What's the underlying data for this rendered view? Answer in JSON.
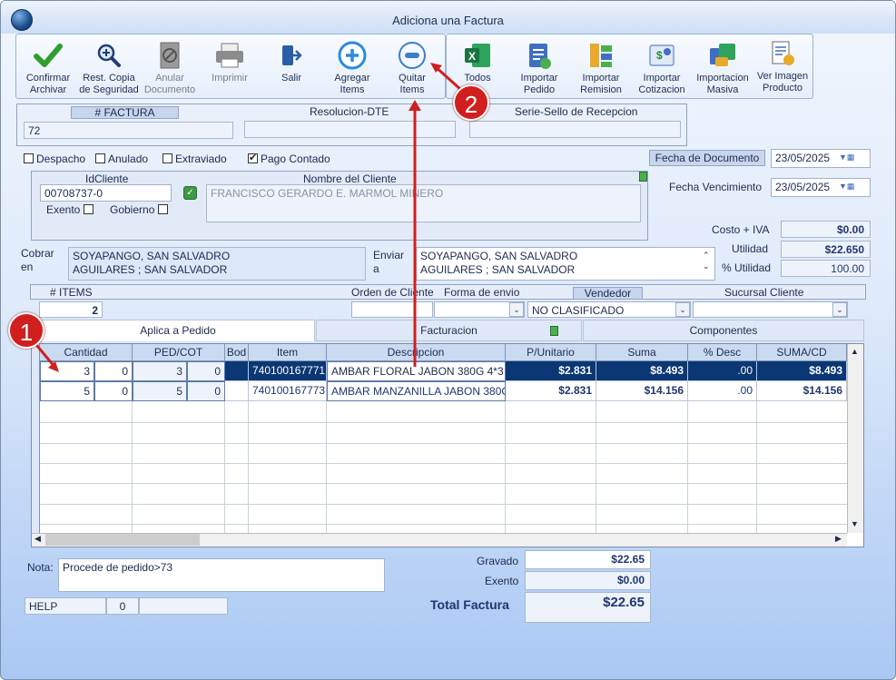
{
  "window": {
    "title": "Adiciona una Factura"
  },
  "toolbar": {
    "confirmar": [
      "Confirmar",
      "Archivar"
    ],
    "rest": [
      "Rest. Copia",
      "de Seguridad"
    ],
    "anular": [
      "Anular",
      "Documento"
    ],
    "imprimir": "Imprimir",
    "salir": "Salir",
    "agregar": [
      "Agregar",
      "Items"
    ],
    "quitar": [
      "Quitar",
      "Items"
    ],
    "todos": "Todos",
    "imp_pedido": [
      "Importar",
      "Pedido"
    ],
    "imp_remision": [
      "Importar",
      "Remision"
    ],
    "imp_cotizacion": [
      "Importar",
      "Cotizacion"
    ],
    "imp_masiva": [
      "Importacion",
      "Masiva"
    ],
    "ver_imagen": [
      "Ver Imagen",
      "Producto"
    ]
  },
  "header": {
    "factura_label": "# FACTURA",
    "factura_value": "72",
    "resolucion_label": "Resolucion-DTE",
    "resolucion_value": "",
    "serie_label": "Serie-Sello de Recepcion",
    "serie_value": "",
    "despacho": "Despacho",
    "anulado": "Anulado",
    "extraviado": "Extraviado",
    "pago_contado": "Pago Contado",
    "fecha_doc_label": "Fecha de  Documento",
    "fecha_doc": "23/05/2025",
    "fecha_venc_label": "Fecha Vencimiento",
    "fecha_venc": "23/05/2025"
  },
  "cliente": {
    "id_label": "IdCliente",
    "id_value": "00708737-0",
    "nombre_label": "Nombre del Cliente",
    "nombre_value": "FRANCISCO GERARDO E. MARMOL MINERO",
    "exento": "Exento",
    "gobierno": "Gobierno",
    "cobrar_label": [
      "Cobrar",
      "en"
    ],
    "cobrar": [
      "SOYAPANGO, SAN SALVADRO",
      "AGUILARES ; SAN SALVADOR"
    ],
    "enviar_label": [
      "Enviar",
      "a"
    ],
    "enviar": [
      "SOYAPANGO, SAN SALVADRO",
      "AGUILARES ; SAN SALVADOR"
    ]
  },
  "resumen": {
    "costo_label": "Costo + IVA",
    "costo": "$0.00",
    "utilidad_label": "Utilidad",
    "utilidad": "$22.650",
    "putilidad_label": "% Utilidad",
    "putilidad": "100.00"
  },
  "bar": {
    "items_label": "# ITEMS",
    "items": "2",
    "orden_label": "Orden de Cliente",
    "forma_label": "Forma de envio",
    "vendedor_label": "Vendedor",
    "vendedor": "NO CLASIFICADO",
    "sucursal_label": "Sucursal Cliente"
  },
  "tabs": [
    "Aplica a Pedido",
    "Facturacion",
    "Componentes"
  ],
  "grid": {
    "columns": [
      "Cantidad",
      "PED/COT",
      "Bod",
      "Item",
      "Descripcion",
      "P/Unitario",
      "Suma",
      "% Desc",
      "SUMA/CD"
    ],
    "rows": [
      {
        "cant": "3",
        "cant2": "0",
        "ped": "3",
        "ped2": "0",
        "item": "740100167771",
        "desc": "AMBAR FLORAL JABON 380G 4*3",
        "pu": "$2.831",
        "suma": "$8.493",
        "desc_pct": ".00",
        "sumacd": "$8.493"
      },
      {
        "cant": "5",
        "cant2": "0",
        "ped": "5",
        "ped2": "0",
        "item": "740100167773",
        "desc": "AMBAR MANZANILLA JABON 380G",
        "pu": "$2.831",
        "suma": "$14.156",
        "desc_pct": ".00",
        "sumacd": "$14.156"
      }
    ]
  },
  "footer": {
    "nota_label": "Nota:",
    "nota": "Procede de pedido>73",
    "help": "HELP",
    "help_n": "0",
    "gravado_label": "Gravado",
    "gravado": "$22.65",
    "exento_label": "Exento",
    "exento": "$0.00",
    "total_label": "Total Factura",
    "total": "$22.65"
  },
  "annotations": {
    "one": "1",
    "two": "2"
  },
  "colors": {
    "accent": "#0b3775",
    "annotation": "#d11f1f"
  }
}
